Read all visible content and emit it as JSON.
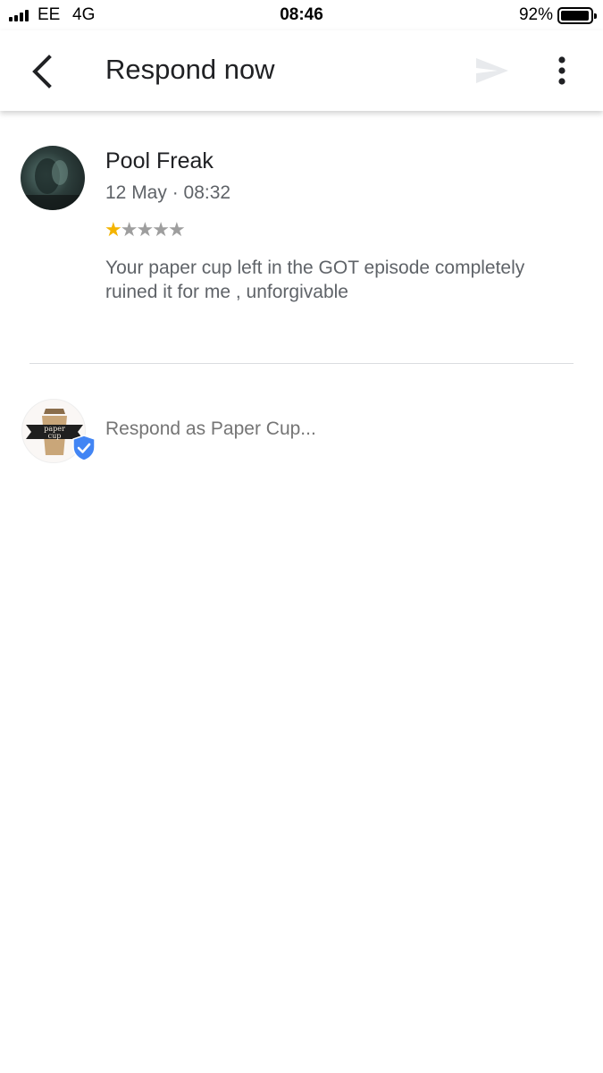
{
  "status_bar": {
    "carrier": "EE",
    "network": "4G",
    "time": "08:46",
    "battery_percent": "92%",
    "battery_level": 0.92
  },
  "app_bar": {
    "title": "Respond now",
    "back_icon": "chevron-left-icon",
    "send_icon": "send-icon",
    "send_enabled": false,
    "more_icon": "more-vert-icon"
  },
  "review": {
    "reviewer_name": "Pool Freak",
    "date": "12 May · 08:32",
    "rating": 1,
    "rating_max": 5,
    "text": "Your paper cup left in the GOT episode completely ruined it for me , unforgivable"
  },
  "respond": {
    "placeholder": "Respond as Paper Cup...",
    "value": "",
    "logo_text_line1": "paper",
    "logo_text_line2": "cup",
    "verified_icon": "verified-shield-icon"
  },
  "colors": {
    "star_filled": "#f4b400",
    "star_empty": "#9e9e9e",
    "verified": "#4285f4",
    "secondary_text": "#5f6368"
  }
}
